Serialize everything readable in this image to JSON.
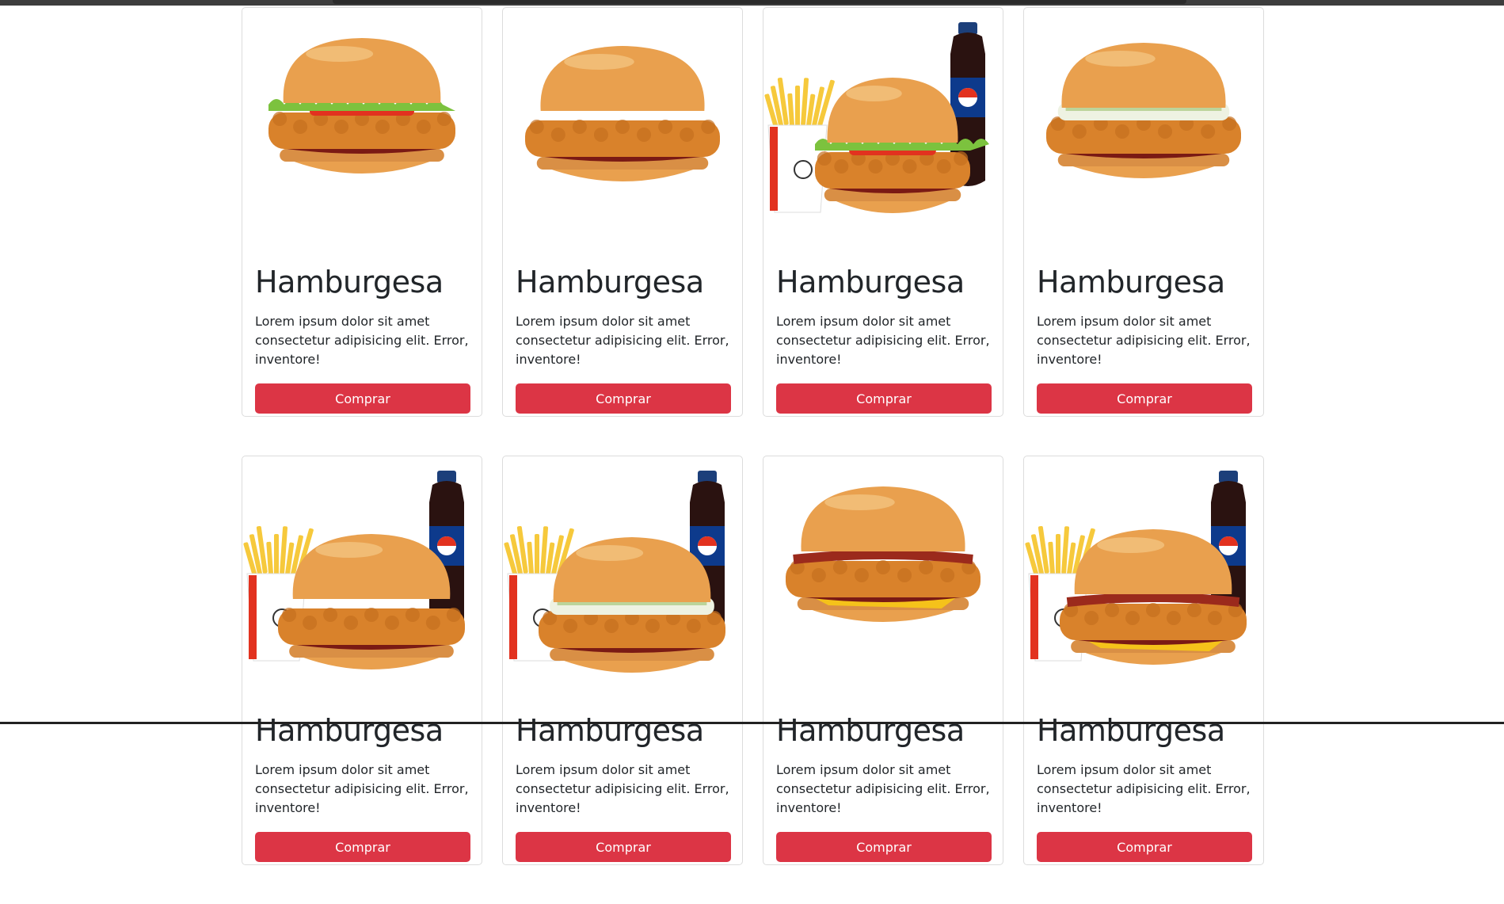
{
  "products": [
    {
      "title": "Hamburgesa",
      "description": "Lorem ipsum dolor sit amet consectetur adipisicing elit. Error, inventore!",
      "button_label": "Comprar",
      "image": "chicken-burger-lettuce-tomato"
    },
    {
      "title": "Hamburgesa",
      "description": "Lorem ipsum dolor sit amet consectetur adipisicing elit. Error, inventore!",
      "button_label": "Comprar",
      "image": "crispy-chicken-burger"
    },
    {
      "title": "Hamburgesa",
      "description": "Lorem ipsum dolor sit amet consectetur adipisicing elit. Error, inventore!",
      "button_label": "Comprar",
      "image": "combo-burger-fries-soda"
    },
    {
      "title": "Hamburgesa",
      "description": "Lorem ipsum dolor sit amet consectetur adipisicing elit. Error, inventore!",
      "button_label": "Comprar",
      "image": "coleslaw-chicken-burger"
    },
    {
      "title": "Hamburgesa",
      "description": "Lorem ipsum dolor sit amet consectetur adipisicing elit. Error, inventore!",
      "button_label": "Comprar",
      "image": "combo-crispy-burger-fries-soda"
    },
    {
      "title": "Hamburgesa",
      "description": "Lorem ipsum dolor sit amet consectetur adipisicing elit. Error, inventore!",
      "button_label": "Comprar",
      "image": "combo-coleslaw-burger-fries-soda"
    },
    {
      "title": "Hamburgesa",
      "description": "Lorem ipsum dolor sit amet consectetur adipisicing elit. Error, inventore!",
      "button_label": "Comprar",
      "image": "bacon-cheese-burger"
    },
    {
      "title": "Hamburgesa",
      "description": "Lorem ipsum dolor sit amet consectetur adipisicing elit. Error, inventore!",
      "button_label": "Comprar",
      "image": "combo-bacon-burger-fries-soda"
    }
  ],
  "colors": {
    "button": "#dc3545",
    "bun": "#e9a04e",
    "chicken": "#d9822b",
    "lettuce": "#7cc23e",
    "tomato": "#e2321f",
    "sauce": "#7a1a14",
    "cheese": "#f5c21a",
    "bacon": "#9b2a1c",
    "soda": "#2a1210",
    "fries": "#f6c93c"
  }
}
